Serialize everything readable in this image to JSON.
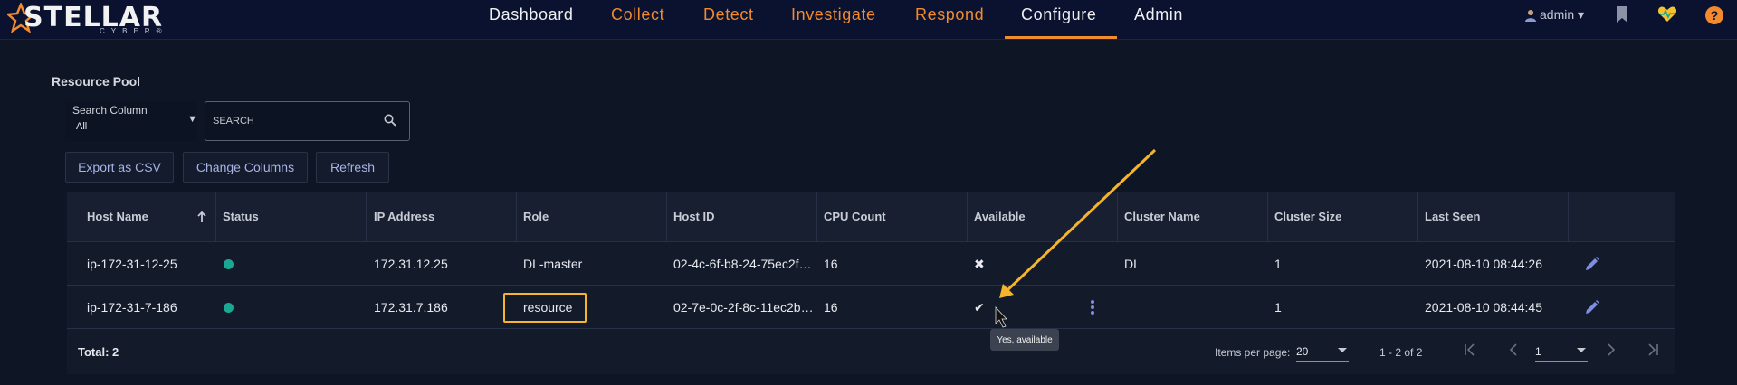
{
  "brand": {
    "name": "STELLAR",
    "sub": "CYBER®"
  },
  "nav": {
    "items": [
      {
        "label": "Dashboard"
      },
      {
        "label": "Collect"
      },
      {
        "label": "Detect"
      },
      {
        "label": "Investigate"
      },
      {
        "label": "Respond"
      },
      {
        "label": "Configure"
      },
      {
        "label": "Admin"
      }
    ],
    "active": "Configure",
    "user": "admin ▾",
    "icons": [
      "bookmark-icon",
      "health-heart-icon",
      "help-icon"
    ]
  },
  "page": {
    "title": "Resource Pool"
  },
  "search": {
    "column_label": "Search Column",
    "column_value": "All",
    "placeholder": "SEARCH"
  },
  "toolbar": {
    "export": "Export as CSV",
    "change_columns": "Change Columns",
    "refresh": "Refresh"
  },
  "table": {
    "columns": [
      "Host Name",
      "Status",
      "IP Address",
      "Role",
      "Host ID",
      "CPU Count",
      "Available",
      "Cluster Name",
      "Cluster Size",
      "Last Seen"
    ],
    "sort": {
      "column": "Host Name",
      "direction": "ascending"
    },
    "rows": [
      {
        "host": "ip-172-31-12-25",
        "status": "online",
        "ip": "172.31.12.25",
        "role": "DL-master",
        "host_id": "02-4c-6f-b8-24-75ec2f…",
        "cpu": "16",
        "available": "✖",
        "cluster": "DL",
        "size": "1",
        "last_seen": "2021-08-10 08:44:26"
      },
      {
        "host": "ip-172-31-7-186",
        "status": "online",
        "ip": "172.31.7.186",
        "role": "resource",
        "host_id": "02-7e-0c-2f-8c-11ec2b…",
        "cpu": "16",
        "available": "✔",
        "cluster": "",
        "size": "1",
        "last_seen": "2021-08-10 08:44:45"
      }
    ],
    "status_color": "#1aa893"
  },
  "footer": {
    "total": "Total: 2",
    "items_per_page_label": "Items per page:",
    "items_per_page": "20",
    "range": "1 - 2 of 2",
    "page": "1"
  },
  "tooltip": "Yes, available",
  "colors": {
    "accent": "#f28a2e",
    "highlight": "#f4b52c",
    "button_text": "#a9b3e6"
  }
}
